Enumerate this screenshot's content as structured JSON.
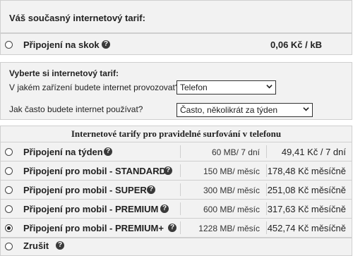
{
  "current": {
    "title": "Váš současný internetový tarif:"
  },
  "skok": {
    "name": "Připojení na skok",
    "price": "0,06 Kč / kB"
  },
  "selection": {
    "heading": "Vyberte si internetový tarif:",
    "device_question": "V jakém zařízení budete internet provozovat?",
    "device_value": "Telefon",
    "frequency_question": "Jak často budete internet používat?",
    "frequency_value": "Často, několikrát za týden"
  },
  "tariffs_header": "Internetové tarify pro pravidelné surfování v telefonu",
  "tariffs": [
    {
      "name": "Připojení na týden",
      "volume": "60 MB/ 7 dní",
      "price": "49,41 Kč / 7 dní",
      "selected": false
    },
    {
      "name": "Připojení pro mobil - STANDARD",
      "volume": "150 MB/ měsíc",
      "price": "178,48 Kč měsíčně",
      "selected": false
    },
    {
      "name": "Připojení pro mobil - SUPER",
      "volume": "300 MB/ měsíc",
      "price": "251,08 Kč měsíčně",
      "selected": false
    },
    {
      "name": "Připojení pro mobil - PREMIUM",
      "volume": "600 MB/ měsíc",
      "price": "317,63 Kč měsíčně",
      "selected": false
    },
    {
      "name": "Připojení pro mobil - PREMIUM+",
      "volume": "1228 MB/ měsíc",
      "price": "452,74 Kč měsíčně",
      "selected": true
    }
  ],
  "cancel": {
    "name": "Zrušit"
  },
  "icons": {
    "help": "help-icon",
    "dropdown": "chevron-down-icon"
  },
  "help_glyph": "?"
}
